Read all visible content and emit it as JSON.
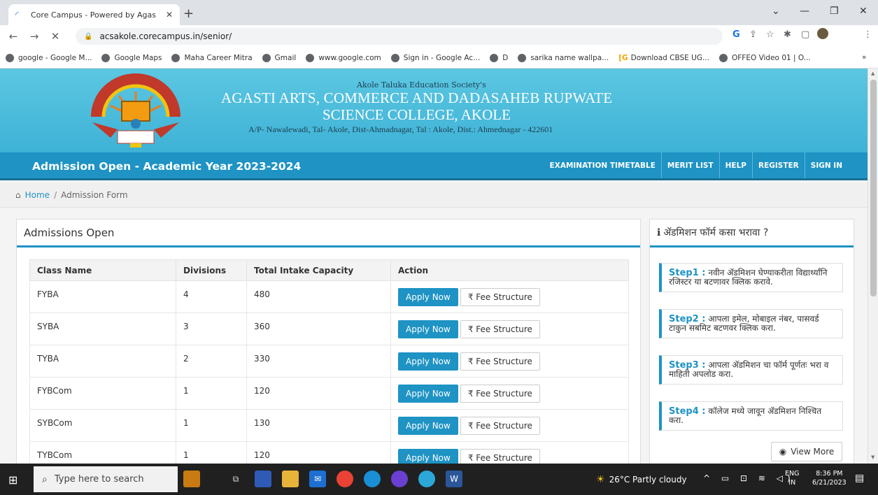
{
  "browser": {
    "tab_title": "Core Campus - Powered by Agas",
    "url": "acsakole.corecampus.in/senior/",
    "bookmarks": [
      "google - Google M...",
      "Google Maps",
      "Maha Career Mitra",
      "Gmail",
      "www.google.com",
      "Sign in - Google Ac...",
      "D",
      "sarika name wallpa...",
      "Download CBSE UG...",
      "OFFEO Video 01 | O..."
    ],
    "bookmarks_more": "»"
  },
  "header": {
    "society": "Akole Taluka Education Society's",
    "college_line1": "AGASTI ARTS, COMMERCE AND DADASAHEB RUPWATE",
    "college_line2": "SCIENCE COLLEGE, AKOLE",
    "address": "A/P- Nawalewadi, Tal- Akole, Dist-Ahmadnagar, Tal : Akole, Dist.: Ahmednagar - 422601"
  },
  "nav": {
    "title": "Admission Open - Academic Year 2023-2024",
    "links": [
      "EXAMINATION TIMETABLE",
      "MERIT LIST",
      "HELP",
      "REGISTER",
      "SIGN IN"
    ]
  },
  "breadcrumb": {
    "home": "Home",
    "separator": "/",
    "current": "Admission Form"
  },
  "admissions": {
    "heading": "Admissions Open",
    "columns": [
      "Class Name",
      "Divisions",
      "Total Intake Capacity",
      "Action"
    ],
    "apply_label": "Apply Now",
    "fee_label": "₹ Fee Structure",
    "rows": [
      {
        "class": "FYBA",
        "divisions": "4",
        "capacity": "480"
      },
      {
        "class": "SYBA",
        "divisions": "3",
        "capacity": "360"
      },
      {
        "class": "TYBA",
        "divisions": "2",
        "capacity": "330"
      },
      {
        "class": "FYBCom",
        "divisions": "1",
        "capacity": "120"
      },
      {
        "class": "SYBCom",
        "divisions": "1",
        "capacity": "130"
      },
      {
        "class": "TYBCom",
        "divisions": "1",
        "capacity": "120"
      }
    ]
  },
  "help_panel": {
    "heading": "ॲडमिशन फॉर्म कसा भरावा ?",
    "steps": [
      {
        "label": "Step1 :",
        "text": "नवीन ॲडमिशन घेण्याकरीता विद्यार्थ्यांनि रजिस्टर या बटणावर क्लिक करावे."
      },
      {
        "label": "Step2 :",
        "text": "आपला इमेल, मोबाइल नंबर, पासवर्ड टाकुन सबमिट बटणवर क्लिक करा."
      },
      {
        "label": "Step3 :",
        "text": "आपला ॲडमिशन चा फॉर्म पूर्णतः भरा व माहिती अपलोड करा."
      },
      {
        "label": "Step4 :",
        "text": "कॉलेज मध्ये जावून ॲडमिशन निश्चित करा."
      }
    ],
    "view_more": "View More"
  },
  "taskbar": {
    "search_placeholder": "Type here to search",
    "weather": "26°C  Partly cloudy",
    "lang1": "ENG",
    "lang2": "IN",
    "time": "8:36 PM",
    "date": "6/21/2023"
  },
  "colors": {
    "accent": "#1e93c4",
    "header_bg": "#4ab9dc",
    "taskbar": "#202020"
  }
}
